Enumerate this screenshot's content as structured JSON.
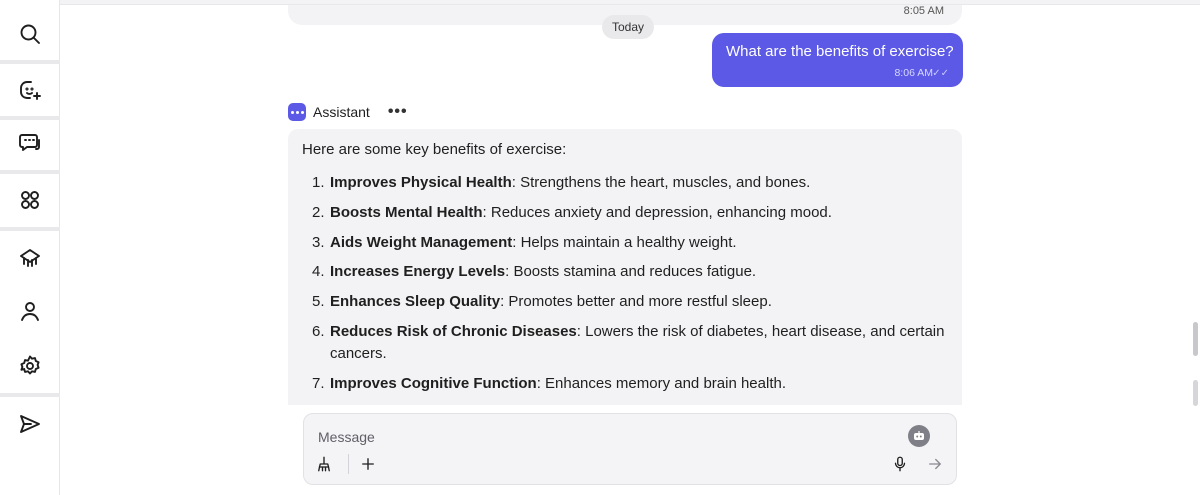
{
  "sidebar": {
    "items": [
      {
        "icon": "search-icon"
      },
      {
        "icon": "new-assistant-icon"
      },
      {
        "icon": "chats-icon"
      },
      {
        "icon": "apps-icon"
      },
      {
        "icon": "models-icon"
      },
      {
        "icon": "user-icon"
      },
      {
        "icon": "settings-icon"
      },
      {
        "icon": "send-icon"
      }
    ]
  },
  "chat": {
    "previous_time": "8:05 AM",
    "day_label": "Today",
    "user_message": {
      "text": "What are the benefits of exercise?",
      "time": "8:06 AM",
      "status": "✓✓"
    },
    "assistant": {
      "name": "Assistant",
      "more": "•••",
      "intro": "Here are some key benefits of exercise:",
      "benefits": [
        {
          "num": "1.",
          "title": "Improves Physical Health",
          "text": ": Strengthens the heart, muscles, and bones."
        },
        {
          "num": "2.",
          "title": "Boosts Mental Health",
          "text": ": Reduces anxiety and depression, enhancing mood."
        },
        {
          "num": "3.",
          "title": "Aids Weight Management",
          "text": ": Helps maintain a healthy weight."
        },
        {
          "num": "4.",
          "title": "Increases Energy Levels",
          "text": ": Boosts stamina and reduces fatigue."
        },
        {
          "num": "5.",
          "title": "Enhances Sleep Quality",
          "text": ": Promotes better and more restful sleep."
        },
        {
          "num": "6.",
          "title": "Reduces Risk of Chronic Diseases",
          "text": ": Lowers the risk of diabetes, heart disease, and certain cancers."
        },
        {
          "num": "7.",
          "title": "Improves Cognitive Function",
          "text": ": Enhances memory and brain health."
        }
      ]
    }
  },
  "composer": {
    "placeholder": "Message"
  },
  "colors": {
    "accent": "#5b59e6",
    "bubble_bg": "#f3f3f5"
  }
}
